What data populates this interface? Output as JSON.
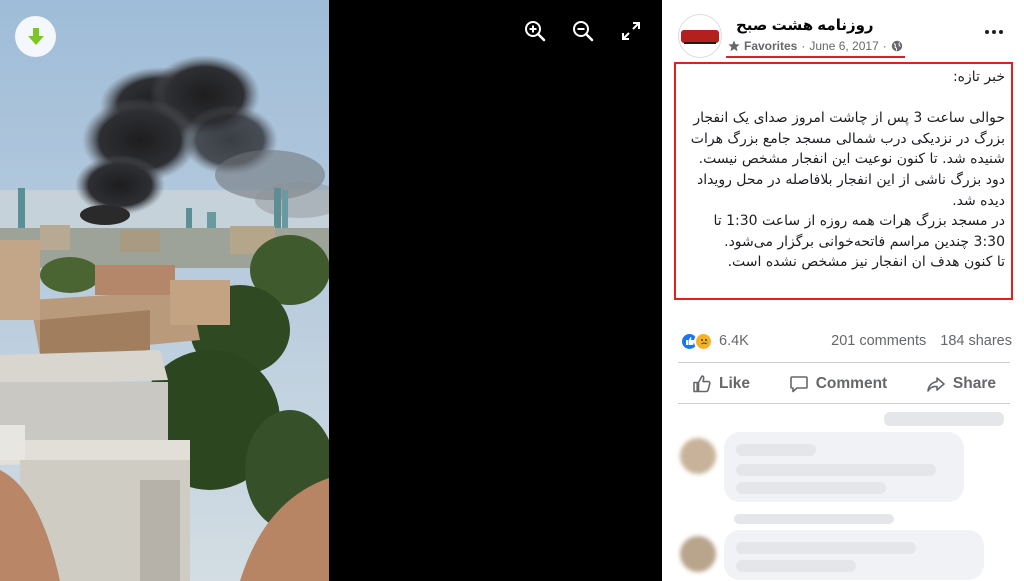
{
  "viewer": {
    "download_icon": "download-arrow-icon",
    "tools": [
      "zoom-in-icon",
      "zoom-out-icon",
      "fullscreen-icon"
    ]
  },
  "post": {
    "page_name": "روزنامه هشت صبح",
    "avatar_text": "۸صبح",
    "favorites_label": "Favorites",
    "date": "June 6, 2017",
    "separator": "·",
    "privacy_icon": "globe-icon",
    "body": [
      "خبر تازه:",
      "",
      "حوالی ساعت 3 پس از چاشت امروز صدای یک انفجار بزرگ در نزدیکی درب شمالی مسجد جامع بزرگ هرات شنیده شد. تا کنون نوعیت این انفجار مشخص نیست.",
      "دود بزرگ ناشی از این انفجار بلافاصله در محل رویداد دیده شد.",
      "در مسجد بزرگ هرات همه روزه از ساعت 1:30 تا 3:30 چندین مراسم فاتحه‌خوانی برگزار می‌شود.",
      "تا کنون هدف ان انفجار نیز مشخص نشده است."
    ],
    "reactions_count": "6.4K",
    "comments_count": "201 comments",
    "shares_count": "184 shares",
    "actions": {
      "like": "Like",
      "comment": "Comment",
      "share": "Share"
    }
  },
  "colors": {
    "highlight": "#e02020",
    "like_blue": "#1877f2",
    "sad_yellow": "#f7b125",
    "muted": "#65676b"
  }
}
